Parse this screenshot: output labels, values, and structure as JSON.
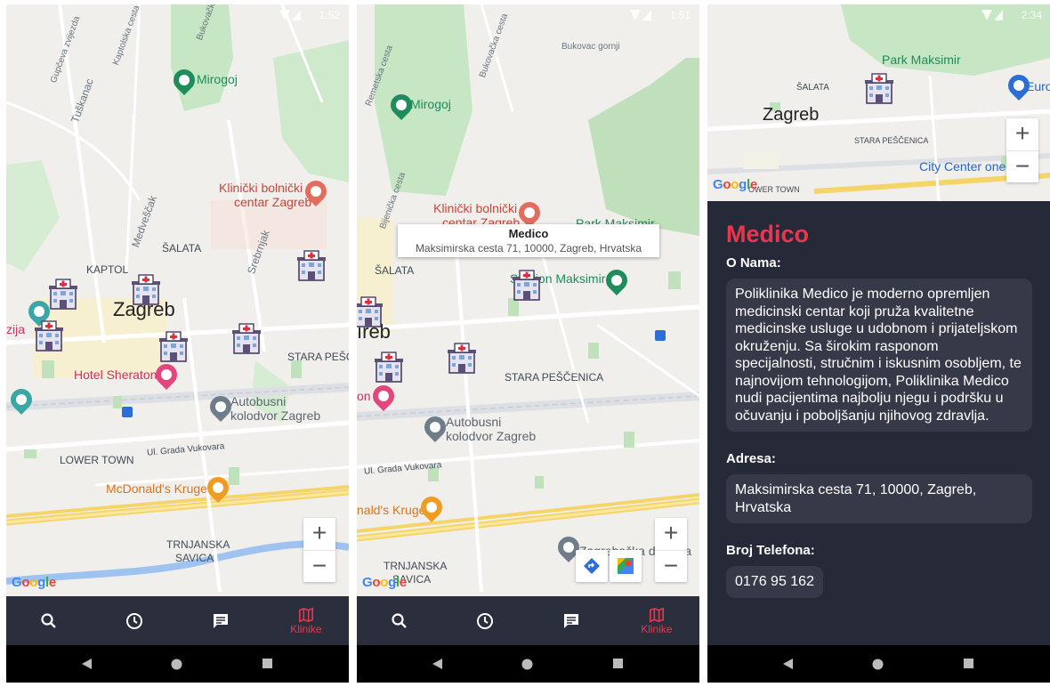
{
  "status": {
    "time1": "1:52",
    "time2": "1:51",
    "time3": "2:34"
  },
  "map_labels": {
    "mirogoj": "Mirogoj",
    "klinicki": [
      "Klinički bolnički",
      "centar Zagreb"
    ],
    "zagreb": "Zagreb",
    "salata": "ŠALATA",
    "kaptol": "KAPTOL",
    "tusk": "Tuškanac",
    "medvedscak": "Medveščak",
    "srebrnjak": "Srebrnjak",
    "hotel_sheraton": "Hotel Sheraton",
    "autobusni": [
      "Autobusni",
      "kolodvor Zagreb"
    ],
    "stara_pescenica": "STARA PEŠČENICA",
    "stara_pesc_short": "STARA PEŠČ",
    "lower_town": "LOWER TOWN",
    "grada_vukovara": "Ul. Grada Vukovara",
    "mcdonalds": "McDonald's Kruge",
    "mcdonalds_cut": "nald's Kruge",
    "trnjanska": [
      "TRNJANSKA",
      "SAVICA"
    ],
    "park_maksimir": "Park Maksimir",
    "stadion": "Stadion Maksimir",
    "zagrebacka": "Zagrebačka džamija",
    "city_center": "City Center one E",
    "euro": "Euro",
    "lower_town_short": "OWER TOWN",
    "zija": "zija",
    "on": "on",
    "ieb": "ıreb",
    "google": "Google"
  },
  "info_window": {
    "name": "Medico",
    "address": "Maksimirska cesta 71, 10000, Zagreb, Hrvatska"
  },
  "zoom": {
    "plus": "+",
    "minus": "−"
  },
  "navbar": {
    "items": [
      {
        "icon": "search-icon"
      },
      {
        "icon": "clock-icon"
      },
      {
        "icon": "chat-icon"
      },
      {
        "icon": "map-icon",
        "label": "Klinike",
        "active": true
      }
    ]
  },
  "detail": {
    "name": "Medico",
    "about_heading": "O Nama:",
    "about_text": "Poliklinika Medico je moderno opremljen medicinski centar koji pruža kvalitetne medicinske usluge u udobnom i prijateljskom okruženju. Sa širokim rasponom specijalnosti, stručnim i iskusnim osobljem, te najnovijom tehnologijom, Poliklinika Medico nudi pacijentima najbolju njegu i podršku u očuvanju i poboljšanju njihovog zdravlja.",
    "address_heading": "Adresa:",
    "address": "Maksimirska cesta 71, 10000, Zagreb, Hrvatska",
    "phone_heading": "Broj Telefona:",
    "phone": "0176 95 162"
  },
  "colors": {
    "accent": "#e8374f",
    "navbar": "#2b2f3d",
    "detail_bg": "#262a38",
    "card": "#363a48"
  }
}
